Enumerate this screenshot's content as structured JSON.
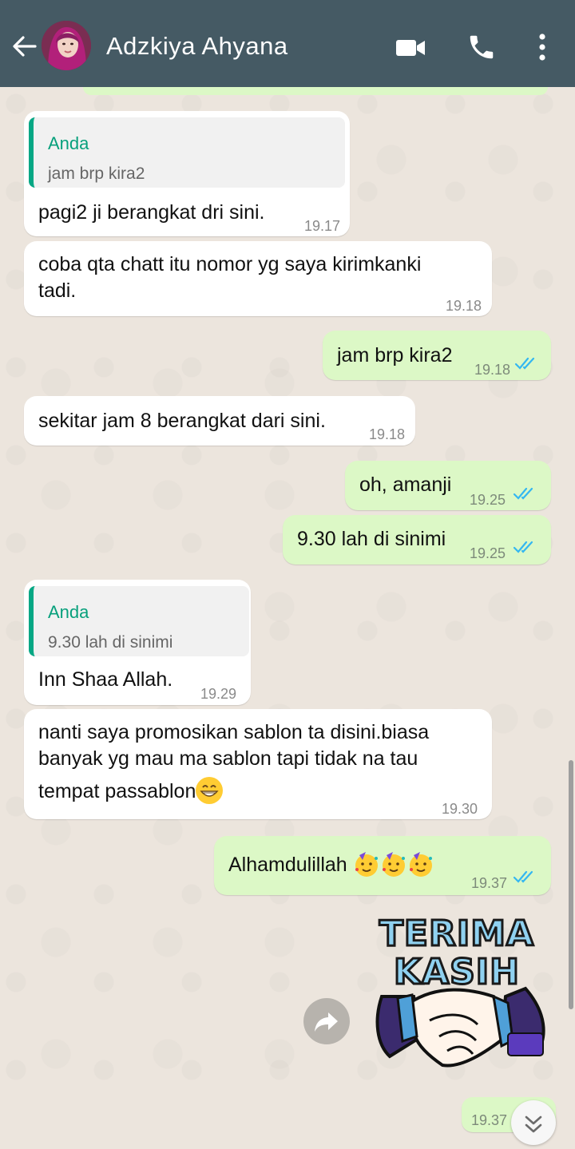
{
  "header": {
    "contact_name": "Adzkiya Ahyana",
    "icons": [
      "back-arrow-icon",
      "avatar",
      "video-call-icon",
      "phone-icon",
      "more-options-icon"
    ],
    "bg_color": "#455A64"
  },
  "messages": [
    {
      "dir": "in",
      "quote_author": "Anda",
      "quote_text": "jam brp kira2",
      "text": "pagi2 ji berangkat dri sini.",
      "time": "19.17"
    },
    {
      "dir": "in",
      "text_lines": [
        "coba qta chatt itu nomor yg saya kirimkanki",
        "tadi."
      ],
      "time": "19.18"
    },
    {
      "dir": "out",
      "text": "jam brp kira2",
      "time": "19.18",
      "read": true
    },
    {
      "dir": "in",
      "text": "sekitar jam 8 berangkat dari sini.",
      "time": "19.18"
    },
    {
      "dir": "out",
      "text": "oh, amanji",
      "time": "19.25",
      "read": true
    },
    {
      "dir": "out",
      "text": "9.30 lah di sinimi",
      "time": "19.25",
      "read": true
    },
    {
      "dir": "in",
      "quote_author": "Anda",
      "quote_text": "9.30 lah di sinimi",
      "text": "Inn Shaa Allah.",
      "time": "19.29"
    },
    {
      "dir": "in",
      "text_lines": [
        "nanti saya promosikan sablon ta disini.biasa",
        "banyak yg mau ma sablon tapi tidak na tau",
        "tempat passablon"
      ],
      "emoji": "grinning-face",
      "time": "19.30"
    },
    {
      "dir": "out",
      "text": "Alhamdulillah",
      "emoji": "partying-face x3",
      "time": "19.37",
      "read": true
    },
    {
      "dir": "out",
      "type": "sticker",
      "sticker_text": [
        "TERIMA",
        "KASIH"
      ],
      "time": "19.37"
    }
  ],
  "colors": {
    "incoming": "#FFFFFF",
    "outgoing": "#DCF8C6",
    "quote_accent": "#06A784",
    "read_ticks": "#34B7F1",
    "wallpaper": "#ECE5DD"
  }
}
